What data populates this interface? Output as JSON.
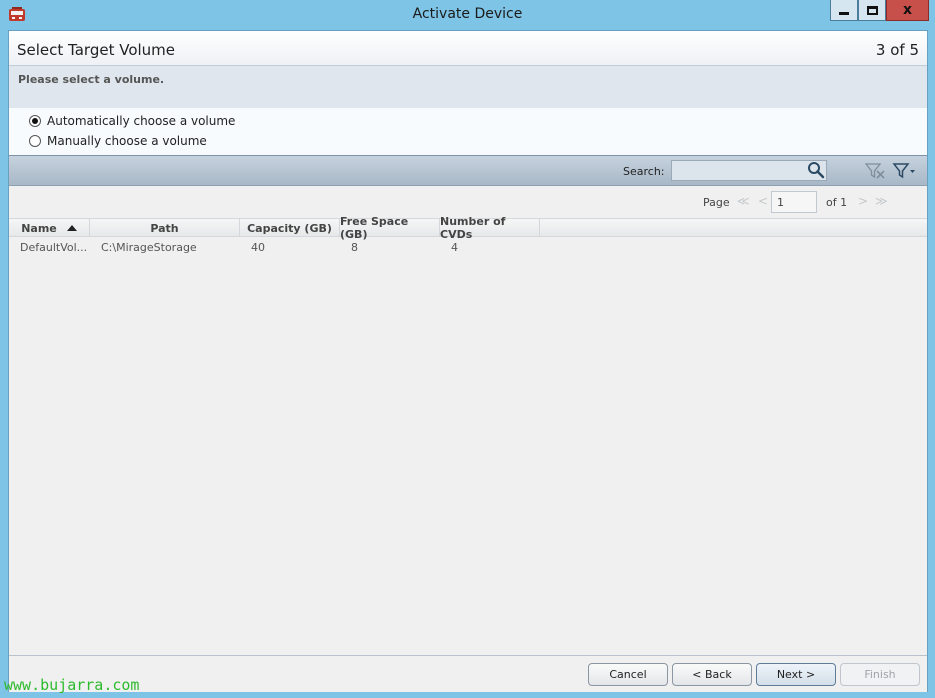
{
  "window": {
    "title": "Activate Device",
    "close_glyph": "x"
  },
  "wizard": {
    "step_title": "Select Target Volume",
    "step_counter": "3 of 5",
    "instruction": "Please select a volume.",
    "options": [
      {
        "label": "Automatically choose a volume",
        "checked": true
      },
      {
        "label": "Manually choose a volume",
        "checked": false
      }
    ]
  },
  "toolbar": {
    "search_label": "Search:",
    "search_value": "",
    "icons": [
      "search-icon",
      "clear-filter-icon",
      "filter-icon"
    ]
  },
  "pager": {
    "label": "Page",
    "current": "1",
    "of_label": "of 1",
    "first": "≪",
    "prev": "<",
    "next": ">",
    "last": "≫"
  },
  "table": {
    "columns": [
      "Name",
      "Path",
      "Capacity (GB)",
      "Free Space (GB)",
      "Number of CVDs"
    ],
    "sort_column": "Name",
    "rows": [
      {
        "name": "DefaultVol...",
        "path": "C:\\MirageStorage",
        "capacity": "40",
        "free_space": "8",
        "cvds": "4"
      }
    ]
  },
  "footer": {
    "cancel": "Cancel",
    "back": "< Back",
    "next": "Next >",
    "finish": "Finish"
  },
  "watermark": "www.bujarra.com",
  "colors": {
    "titlebar": "#7ec4e6",
    "close_button": "#c7504a",
    "watermark": "#2dbb2d"
  }
}
